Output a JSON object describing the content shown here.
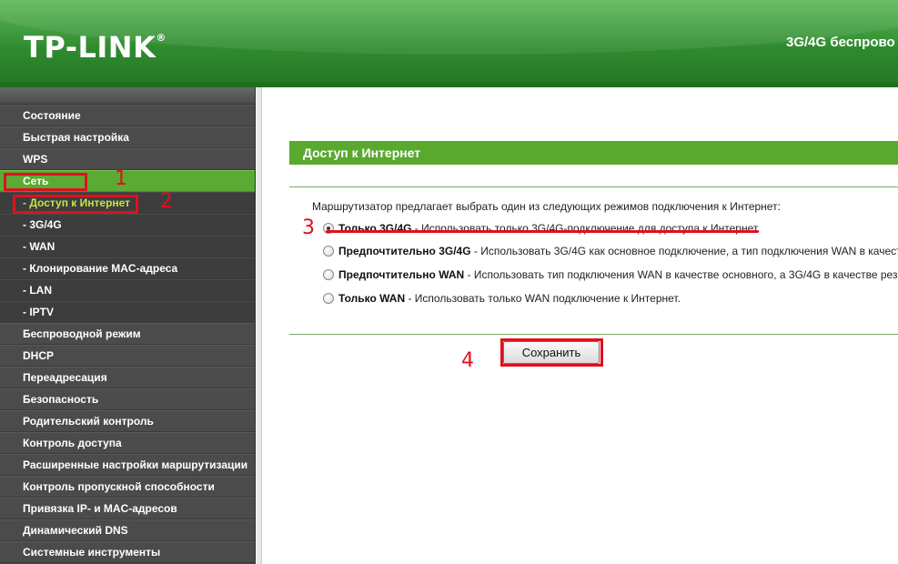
{
  "header": {
    "logo": "TP-LINK",
    "logo_mark": "®",
    "model": "3G/4G беспрово"
  },
  "sidebar": {
    "items": [
      {
        "label": "Состояние"
      },
      {
        "label": "Быстрая настройка"
      },
      {
        "label": "WPS"
      },
      {
        "label": "Сеть",
        "active": true
      },
      {
        "label": "- Доступ к Интернет",
        "sub": true,
        "active": true
      },
      {
        "label": "- 3G/4G",
        "sub": true
      },
      {
        "label": "- WAN",
        "sub": true
      },
      {
        "label": "- Клонирование MAC-адреса",
        "sub": true
      },
      {
        "label": "- LAN",
        "sub": true
      },
      {
        "label": "- IPTV",
        "sub": true
      },
      {
        "label": "Беспроводной режим"
      },
      {
        "label": "DHCP"
      },
      {
        "label": "Переадресация"
      },
      {
        "label": "Безопасность"
      },
      {
        "label": "Родительский контроль"
      },
      {
        "label": "Контроль доступа"
      },
      {
        "label": "Расширенные настройки маршрутизации"
      },
      {
        "label": "Контроль пропускной способности"
      },
      {
        "label": "Привязка IP- и MAC-адресов"
      },
      {
        "label": "Динамический DNS"
      },
      {
        "label": "Системные инструменты"
      }
    ]
  },
  "main": {
    "section_title": "Доступ к Интернет",
    "intro": "Маршрутизатор предлагает выбрать один из следующих режимов подключения к Интернет:",
    "options": [
      {
        "name": "Только 3G/4G",
        "desc": " - Использовать только 3G/4G-подключение для доступа к Интернет.",
        "checked": true
      },
      {
        "name": "Предпочтительно 3G/4G",
        "desc": " - Использовать 3G/4G как основное подключение, а тип подключения WAN в качест",
        "checked": false
      },
      {
        "name": "Предпочтительно WAN",
        "desc": " - Использовать тип подключения WAN в качестве основного, а 3G/4G в качестве рез",
        "checked": false
      },
      {
        "name": "Только WAN",
        "desc": " - Использовать только WAN подключение к Интернет.",
        "checked": false
      }
    ],
    "save_label": "Сохранить"
  },
  "annotations": {
    "n1": "1",
    "n2": "2",
    "n3": "3",
    "n4": "4",
    "color": "#e0101e"
  },
  "colors": {
    "header_green": "#2f8a2f",
    "menu_active": "#5aaa33",
    "submenu_active_text": "#c6e34a",
    "section_bar": "#5aa92f",
    "sidebar_bg": "#4a4a4a"
  }
}
